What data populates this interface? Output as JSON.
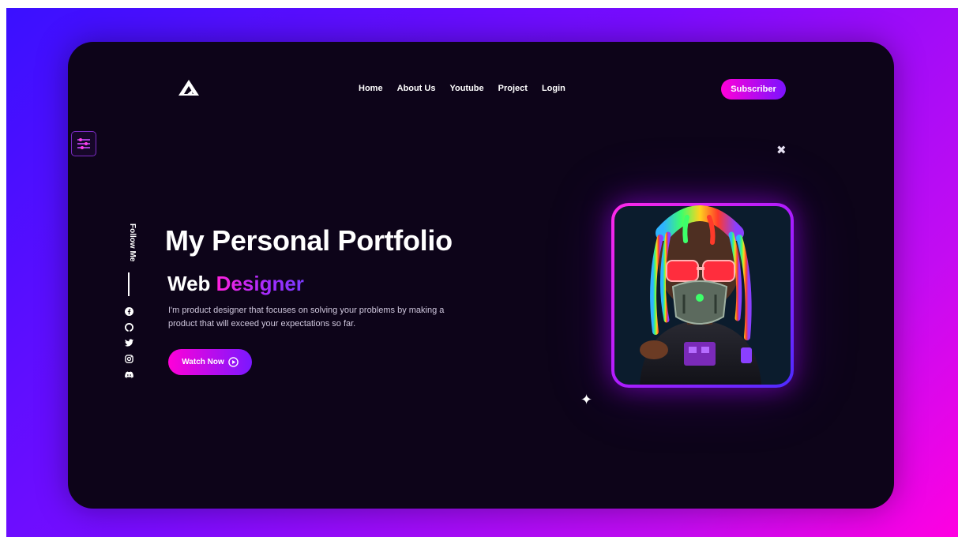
{
  "nav": {
    "logo": "triangle-logo",
    "links": [
      "Home",
      "About Us",
      "Youtube",
      "Project",
      "Login"
    ],
    "subscribe_label": "Subscriber"
  },
  "sidebar": {
    "follow_label": "Follow Me",
    "socials": [
      "facebook-icon",
      "github-icon",
      "twitter-icon",
      "instagram-icon",
      "discord-icon"
    ]
  },
  "hero": {
    "title": "My Personal Portfolio",
    "subtitle_prefix": "Web",
    "subtitle_highlight": "Designer",
    "description": "I'm product designer that focuses on solving your problems by making a product that will exceed your expectations so far.",
    "cta_label": "Watch Now"
  },
  "colors": {
    "accent_pink": "#ff00d8",
    "accent_purple": "#7a18ff",
    "card_bg": "#0d0419",
    "page_gradient_start": "#3a10ff",
    "page_gradient_end": "#ff00e1"
  }
}
